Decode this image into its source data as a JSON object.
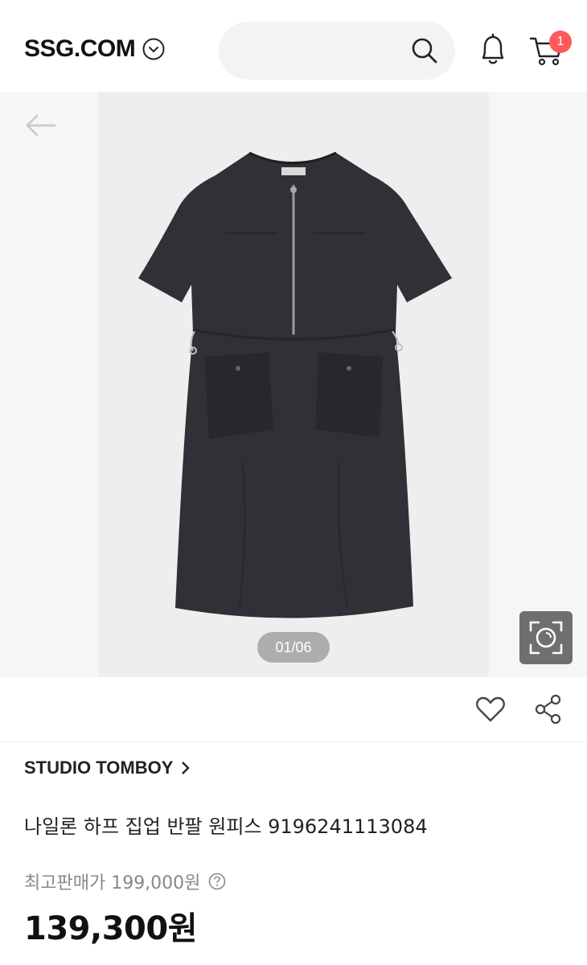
{
  "header": {
    "logo": "SSG.COM",
    "search": {
      "placeholder": "",
      "value": ""
    },
    "cart_count": "1"
  },
  "gallery": {
    "counter": "01/06"
  },
  "product": {
    "brand": "STUDIO TOMBOY",
    "title": "나일론 하프 집업 반팔 원피스 9196241113084",
    "max_price_label": "최고판매가 199,000원",
    "price": "139,300원"
  },
  "colors": {
    "badge": "#ff5a5a",
    "garment": "#2f3136"
  }
}
